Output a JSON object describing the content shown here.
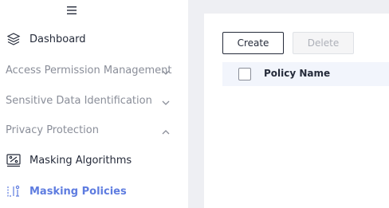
{
  "sidebar": {
    "collapse_icon": "hamburger-icon",
    "dashboard": {
      "label": "Dashboard",
      "icon": "layers-icon"
    },
    "groups": [
      {
        "label": "Access Permission Management",
        "expanded": false
      },
      {
        "label": "Sensitive Data Identification",
        "expanded": false
      },
      {
        "label": "Privacy Protection",
        "expanded": true
      }
    ],
    "privacy_items": [
      {
        "label": "Masking Algorithms",
        "icon": "masking-algorithm-icon",
        "active": false
      },
      {
        "label": "Masking Policies",
        "icon": "masking-policy-icon",
        "active": true
      }
    ]
  },
  "toolbar": {
    "create_label": "Create",
    "delete_label": "Delete"
  },
  "table": {
    "columns": [
      "Policy Name"
    ]
  },
  "colors": {
    "accent": "#5e7ce0",
    "text": "#252b3a",
    "muted": "#8a8e99",
    "background": "#eeeff3"
  }
}
